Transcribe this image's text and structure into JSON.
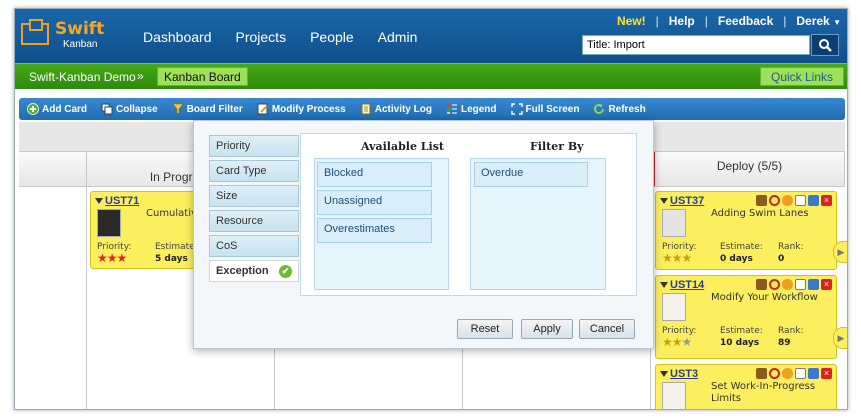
{
  "header": {
    "logo_text": "Swift",
    "logo_sub": "Kanban",
    "nav": [
      "Dashboard",
      "Projects",
      "People",
      "Admin"
    ],
    "top_links": {
      "new": "New!",
      "help": "Help",
      "feedback": "Feedback",
      "user": "Derek"
    },
    "search_value": "Title: Import"
  },
  "breadcrumb": {
    "project": "Swift-Kanban Demo",
    "separator": "»",
    "current": "Kanban Board",
    "quick_links": "Quick Links"
  },
  "toolbar": {
    "items": [
      {
        "label": "Add Card",
        "icon": "add-icon"
      },
      {
        "label": "Collapse",
        "icon": "collapse-icon"
      },
      {
        "label": "Board Filter",
        "icon": "filter-icon"
      },
      {
        "label": "Modify Process",
        "icon": "modify-icon"
      },
      {
        "label": "Activity Log",
        "icon": "log-icon"
      },
      {
        "label": "Legend",
        "icon": "legend-icon"
      },
      {
        "label": "Full Screen",
        "icon": "fullscreen-icon"
      },
      {
        "label": "Refresh",
        "icon": "refresh-icon"
      }
    ]
  },
  "board": {
    "lanes": {
      "in_progress": "In Progress",
      "deploy": "Deploy (5/5)"
    },
    "in_progress_card": {
      "id": "UST71",
      "title": "Cumulative",
      "priority_label": "Priority:",
      "estimate_label": "Estimate",
      "estimate_value": "5 days",
      "stars": 3,
      "star_color": "#e02424"
    },
    "deploy_cards": [
      {
        "id": "UST37",
        "title": "Adding Swim Lanes",
        "priority_label": "Priority:",
        "estimate_label": "Estimate:",
        "estimate_value": "0 days",
        "rank_label": "Rank:",
        "rank_value": "0",
        "stars": 3
      },
      {
        "id": "UST14",
        "title": "Modify Your Workflow",
        "priority_label": "Priority:",
        "estimate_label": "Estimate:",
        "estimate_value": "10 days",
        "rank_label": "Rank:",
        "rank_value": "89",
        "stars": 2
      },
      {
        "id": "UST3",
        "title": "Set Work-In-Progress Limits"
      }
    ]
  },
  "filter_dialog": {
    "tabs": [
      "Priority",
      "Card Type",
      "Size",
      "Resource",
      "CoS",
      "Exception"
    ],
    "active_tab": "Exception",
    "available_title": "Available List",
    "filter_title": "Filter By",
    "available_items": [
      "Blocked",
      "Unassigned",
      "Overestimates"
    ],
    "filter_items": [
      "Overdue"
    ],
    "buttons": {
      "reset": "Reset",
      "apply": "Apply",
      "cancel": "Cancel"
    }
  },
  "colors": {
    "header_blue": "#155c9c",
    "crumb_green": "#3a9a12",
    "card_yellow": "#fbef5e",
    "accent_orange": "#f6a623"
  }
}
